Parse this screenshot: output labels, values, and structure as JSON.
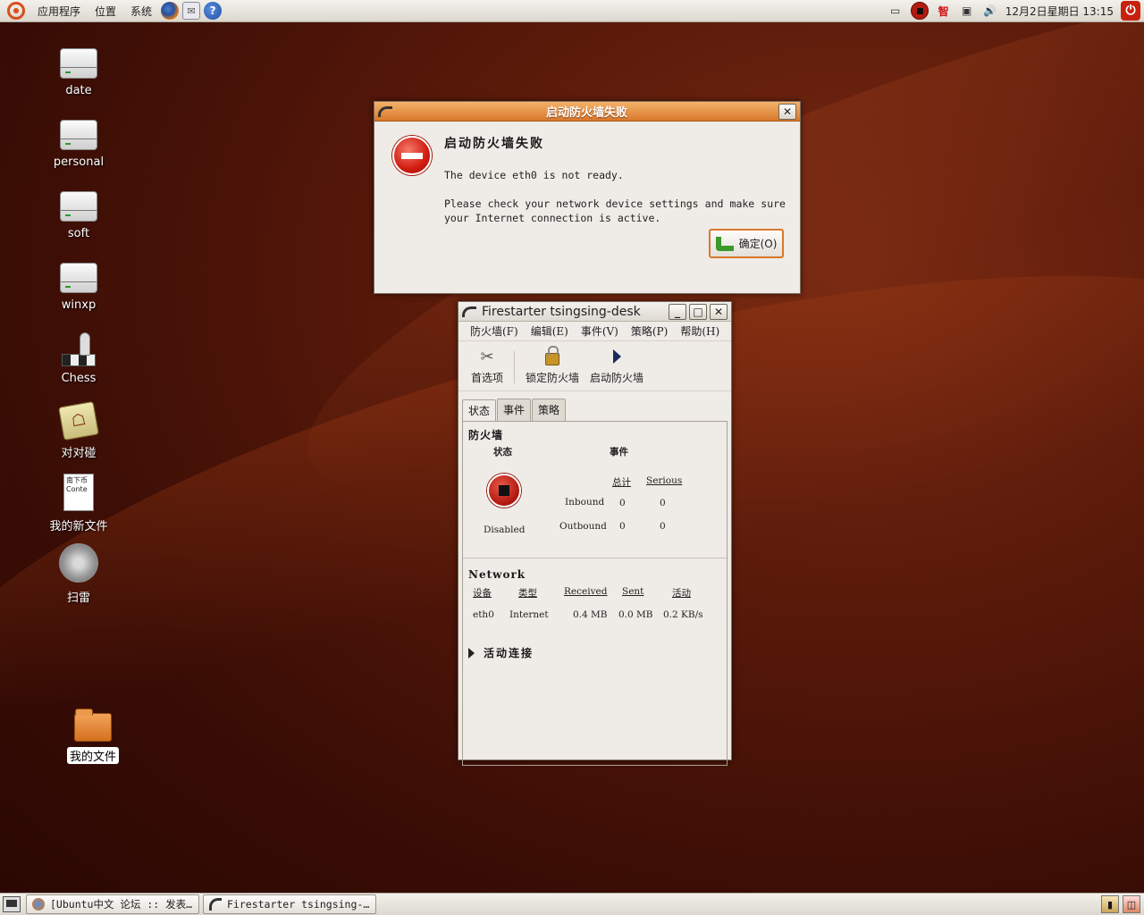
{
  "top_panel": {
    "menus": [
      "应用程序",
      "位置",
      "系统"
    ],
    "tray_char": "智",
    "clock": "12月2日星期日  13:15"
  },
  "desktop_icons": [
    {
      "label": "date"
    },
    {
      "label": "personal"
    },
    {
      "label": "soft"
    },
    {
      "label": "winxp"
    },
    {
      "label": "Chess"
    },
    {
      "label": "对对碰"
    },
    {
      "label": "我的新文件",
      "doc_text": "南下币 Conte"
    },
    {
      "label": "扫雷"
    },
    {
      "label": "我的文件"
    }
  ],
  "error_dialog": {
    "title": "启动防火墙失败",
    "heading": "启动防火墙失败",
    "message1": "The device eth0 is not ready.",
    "message2": "Please check your network device settings and make sure your Internet connection is active.",
    "ok_label": "确定(O)"
  },
  "firestarter": {
    "title": "Firestarter tsingsing-desk",
    "menu": [
      "防火墙(F)",
      "编辑(E)",
      "事件(V)",
      "策略(P)",
      "帮助(H)"
    ],
    "toolbar": {
      "prefs": "首选项",
      "lock": "锁定防火墙",
      "start": "启动防火墙"
    },
    "tabs": [
      "状态",
      "事件",
      "策略"
    ],
    "firewall_section": "防火墙",
    "status_header": "状态",
    "events_header": "事件",
    "status_value": "Disabled",
    "col_total": "总计",
    "col_serious": "Serious",
    "rows": [
      {
        "label": "Inbound",
        "total": "0",
        "serious": "0"
      },
      {
        "label": "Outbound",
        "total": "0",
        "serious": "0"
      }
    ],
    "network_section": "Network",
    "net_headers": {
      "device": "设备",
      "type": "类型",
      "received": "Received",
      "sent": "Sent",
      "activity": "活动"
    },
    "net_row": {
      "device": "eth0",
      "type": "Internet",
      "received": "0.4 MB",
      "sent": "0.0 MB",
      "activity": "0.2 KB/s"
    },
    "active_connections": "活动连接"
  },
  "taskbar": {
    "tasks": [
      "[Ubuntu中文 论坛 :: 发表…",
      "Firestarter tsingsing-…"
    ]
  }
}
